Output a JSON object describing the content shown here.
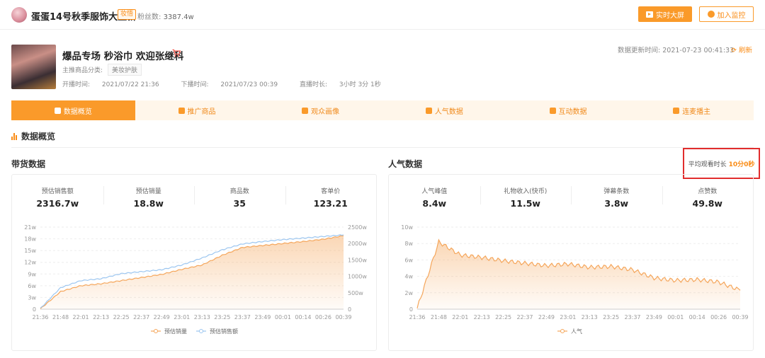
{
  "header": {
    "anchor_name": "蛋蛋14号秋季服饰大上新",
    "badge": "妆悟",
    "fans_label": "粉丝数:",
    "fans_value": "3387.4w",
    "btn_realtime": "实时大屏",
    "btn_monitor": "加入监控",
    "accent": "#fa9a2a"
  },
  "live": {
    "title": "爆品专场 秒浴巾 欢迎张继科",
    "main_category_label": "主推商品分类:",
    "main_category": "美妆护肤",
    "start_label": "开播时间:",
    "start_time": "2021/07/22 21:36",
    "end_label": "下播时间:",
    "end_time": "2021/07/23 00:39",
    "duration_label": "直播时长:",
    "duration": "3小时 3分 1秒",
    "update_label": "数据更新时间:",
    "update_time": "2021-07-23 00:41:33",
    "refresh": "刷新"
  },
  "tabs": [
    {
      "label": "数据概览",
      "active": true
    },
    {
      "label": "推广商品"
    },
    {
      "label": "观众画像"
    },
    {
      "label": "人气数据"
    },
    {
      "label": "互动数据"
    },
    {
      "label": "连麦播主"
    }
  ],
  "section_title": "数据概览",
  "sales": {
    "title": "带货数据",
    "stats": [
      {
        "label": "预估销售额",
        "value": "2316.7w"
      },
      {
        "label": "预估销量",
        "value": "18.8w"
      },
      {
        "label": "商品数",
        "value": "35"
      },
      {
        "label": "客单价",
        "value": "123.21"
      }
    ],
    "legend": [
      "预估销量",
      "预估销售额"
    ]
  },
  "popularity": {
    "title": "人气数据",
    "avg_label": "平均观看时长",
    "avg_value": "10分0秒",
    "stats": [
      {
        "label": "人气峰值",
        "value": "8.4w"
      },
      {
        "label": "礼物收入(快币)",
        "value": "11.5w"
      },
      {
        "label": "弹幕条数",
        "value": "3.8w"
      },
      {
        "label": "点赞数",
        "value": "49.8w"
      }
    ],
    "legend": [
      "人气"
    ]
  },
  "chart_data": [
    {
      "type": "area",
      "title": "",
      "categories": [
        "21:36",
        "21:48",
        "22:01",
        "22:13",
        "22:25",
        "22:37",
        "22:49",
        "23:01",
        "23:13",
        "23:25",
        "23:37",
        "23:49",
        "00:01",
        "00:14",
        "00:26",
        "00:39"
      ],
      "y_left_ticks": [
        "0",
        "3w",
        "6w",
        "9w",
        "12w",
        "15w",
        "18w",
        "21w"
      ],
      "y_right_ticks": [
        "0",
        "500w",
        "1000w",
        "1500w",
        "2000w",
        "2500w"
      ],
      "ylim_left": [
        0,
        21
      ],
      "ylim_right": [
        0,
        2500
      ],
      "series": [
        {
          "name": "预估销量",
          "axis": "left",
          "color": "#f5a65b",
          "fill": true,
          "values": [
            0.1,
            4.5,
            6.0,
            6.5,
            7.3,
            8.1,
            8.9,
            10.2,
            11.3,
            13.8,
            15.8,
            16.3,
            16.8,
            17.3,
            17.9,
            18.8
          ]
        },
        {
          "name": "预估销售额",
          "axis": "left",
          "color": "#9cc6f0",
          "fill": false,
          "values": [
            0.2,
            5.5,
            7.3,
            7.8,
            9.1,
            9.6,
            10.1,
            11.3,
            13.1,
            15.2,
            16.7,
            17.3,
            17.8,
            18.2,
            18.6,
            19.0
          ]
        }
      ]
    },
    {
      "type": "area",
      "title": "",
      "categories": [
        "21:36",
        "21:48",
        "22:01",
        "22:13",
        "22:25",
        "22:37",
        "22:49",
        "23:01",
        "23:13",
        "23:25",
        "23:37",
        "23:49",
        "00:01",
        "00:14",
        "00:26",
        "00:39"
      ],
      "y_ticks": [
        "0",
        "2w",
        "4w",
        "6w",
        "8w",
        "10w"
      ],
      "ylim": [
        0,
        10
      ],
      "series": [
        {
          "name": "人气",
          "color": "#f5a65b",
          "fill": true,
          "values": [
            0.1,
            8.2,
            6.6,
            6.3,
            5.9,
            5.6,
            5.3,
            5.5,
            5.1,
            5.2,
            4.8,
            3.8,
            3.5,
            3.6,
            3.3,
            2.3
          ]
        }
      ]
    }
  ]
}
